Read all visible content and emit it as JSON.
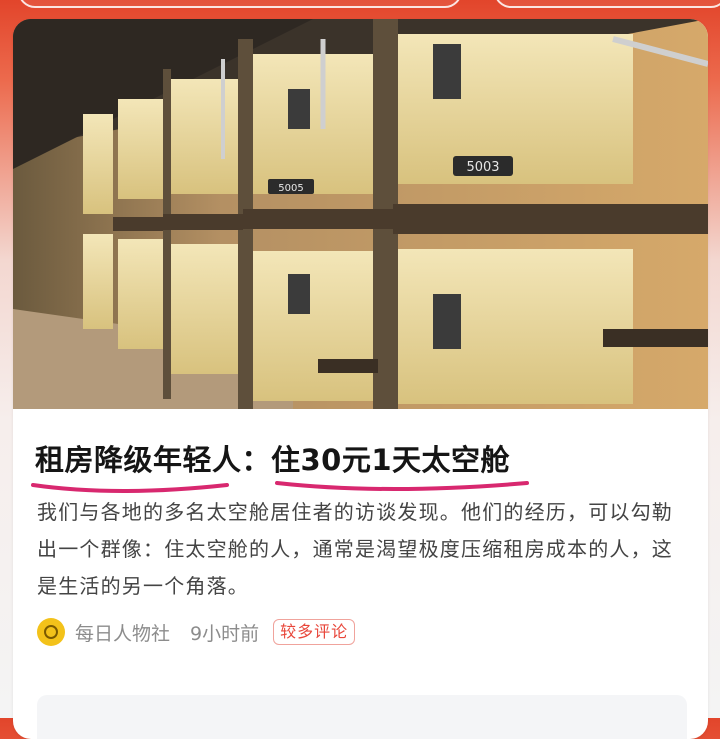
{
  "article": {
    "title": "租房降级年轻人：住30元1天太空舱",
    "summary": "我们与各地的多名太空舱居住者的访谈发现。他们的经历，可以勾勒出一个群像：住太空舱的人，通常是渴望极度压缩租房成本的人，这是生活的另一个角落。",
    "image": {
      "description": "capsule hotel pods photo",
      "pod_numbers": [
        "5003",
        "5005"
      ]
    },
    "source": "每日人物社",
    "time": "9小时前",
    "tag": "较多评论",
    "underline_color": "#d8286f",
    "avatar_icon": "coin-icon"
  },
  "colors": {
    "header_red": "#e2452b",
    "tag_red": "#e8463a"
  }
}
